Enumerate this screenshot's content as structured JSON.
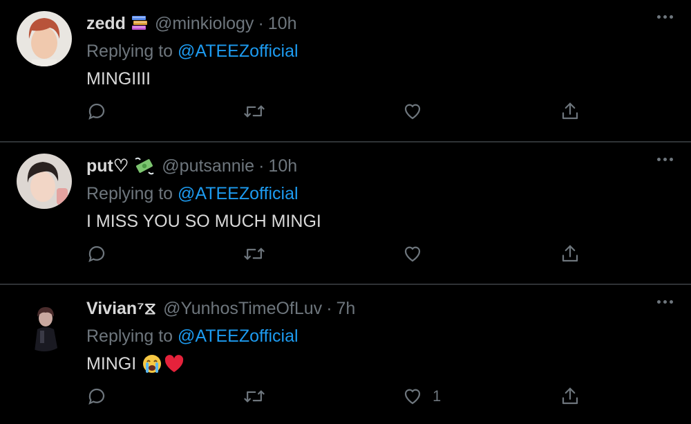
{
  "tweets": [
    {
      "name": "zedd",
      "badge_icon": "books-emoji",
      "handle": "@minkiology",
      "separator": "·",
      "time": "10h",
      "reply_prefix": "Replying to",
      "reply_mention": "@ATEEZofficial",
      "text": "MINGIIII",
      "like_count": ""
    },
    {
      "name": "put♡",
      "badge_icon": "money-with-wings-emoji",
      "handle": "@putsannie",
      "separator": "·",
      "time": "10h",
      "reply_prefix": "Replying to",
      "reply_mention": "@ATEEZofficial",
      "text": "I MISS YOU SO MUCH MINGI",
      "like_count": ""
    },
    {
      "name": "Vivian⁷⧖",
      "badge_icon": "",
      "handle": "@YunhosTimeOfLuv",
      "separator": "·",
      "time": "7h",
      "reply_prefix": "Replying to",
      "reply_mention": "@ATEEZofficial",
      "text": "MINGI",
      "text_emojis": [
        "loudly-crying-face-emoji",
        "red-heart-emoji"
      ],
      "like_count": "1"
    }
  ],
  "colors": {
    "background": "#000000",
    "text": "#d9d9d9",
    "muted": "#6e767d",
    "mention": "#1d9bf0",
    "divider": "#2f3336"
  }
}
